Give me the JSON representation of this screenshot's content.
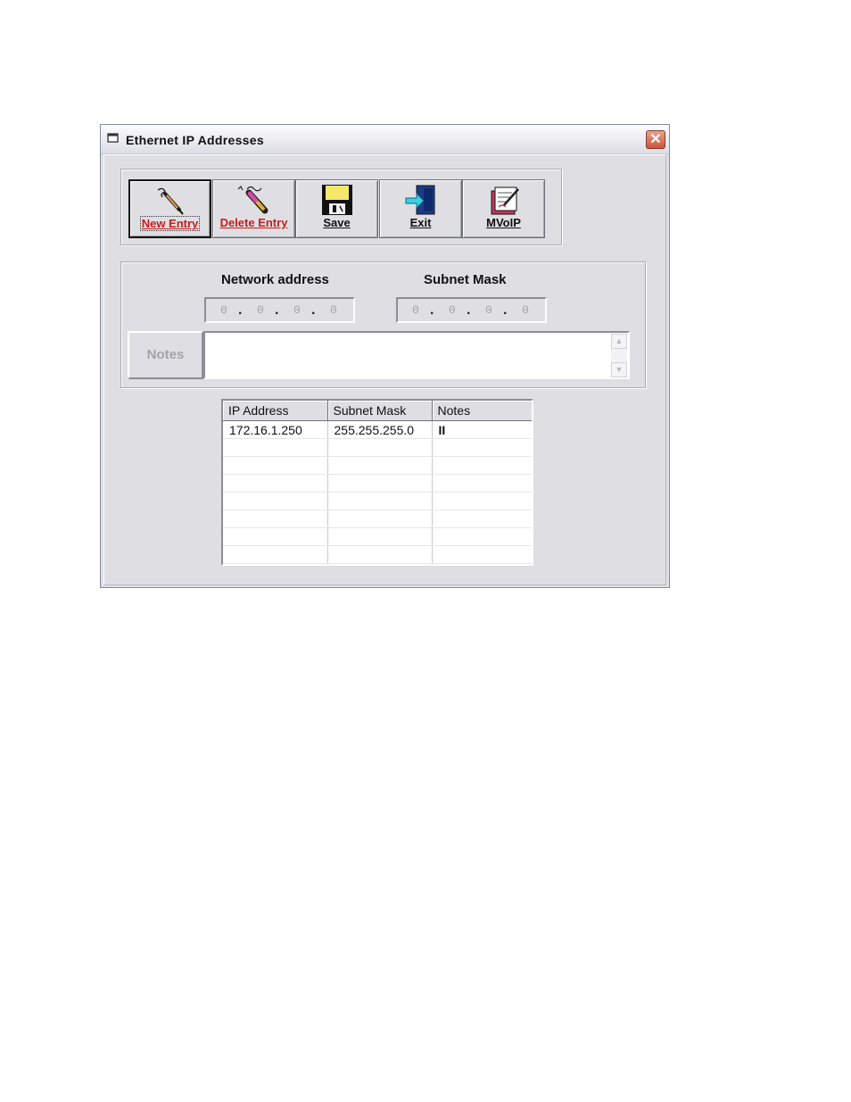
{
  "window": {
    "title": "Ethernet IP Addresses"
  },
  "toolbar": {
    "buttons": [
      {
        "label": "New Entry",
        "icon": "pen-icon"
      },
      {
        "label": "Delete Entry",
        "icon": "eraser-icon"
      },
      {
        "label": "Save",
        "icon": "floppy-disk-icon"
      },
      {
        "label": "Exit",
        "icon": "exit-door-icon"
      },
      {
        "label": "MVoIP",
        "icon": "notepad-icon"
      }
    ]
  },
  "entry": {
    "network_address_label": "Network address",
    "subnet_mask_label": "Subnet Mask",
    "network_address": [
      "0",
      "0",
      "0",
      "0"
    ],
    "subnet_mask": [
      "0",
      "0",
      "0",
      "0"
    ],
    "notes_label": "Notes",
    "notes_value": ""
  },
  "table": {
    "columns": [
      "IP Address",
      "Subnet Mask",
      "Notes"
    ],
    "rows": [
      [
        "172.16.1.250",
        "255.255.255.0",
        "II"
      ],
      [
        "",
        "",
        ""
      ],
      [
        "",
        "",
        ""
      ],
      [
        "",
        "",
        ""
      ],
      [
        "",
        "",
        ""
      ],
      [
        "",
        "",
        ""
      ],
      [
        "",
        "",
        ""
      ],
      [
        "",
        "",
        ""
      ]
    ]
  }
}
